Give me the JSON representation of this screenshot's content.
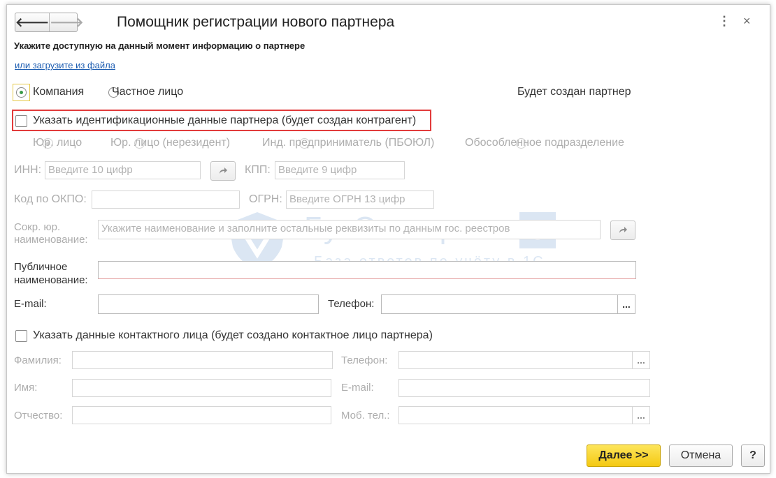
{
  "window": {
    "title": "Помощник регистрации нового партнера",
    "nav": {
      "back": "🡐",
      "forward": "🡒"
    },
    "menu_icon": "⋮",
    "close_icon": "×"
  },
  "prompt": "Укажите доступную на данный момент информацию о партнере",
  "load_link": "или загрузите из файла",
  "partner_type": {
    "company": "Компания",
    "private": "Частное лицо",
    "selected": "company"
  },
  "will_create": "Будет создан партнер",
  "ident_checkbox": "Указать идентификационные данные партнера (будет создан контрагент)",
  "legal_types": [
    "Юр. лицо",
    "Юр. лицо (нерезидент)",
    "Инд. предприниматель (ПБОЮЛ)",
    "Обособленное подразделение"
  ],
  "fields": {
    "inn_label": "ИНН:",
    "inn_placeholder": "Введите 10 цифр",
    "kpp_label": "КПП:",
    "kpp_placeholder": "Введите 9 цифр",
    "okpo_label": "Код по ОКПО:",
    "ogrn_label": "ОГРН:",
    "ogrn_placeholder": "Введите ОГРН 13 цифр",
    "short_name_label_1": "Сокр. юр.",
    "short_name_label_2": "наименование:",
    "short_name_placeholder": "Укажите наименование и заполните остальные реквизиты по данным гос. реестров",
    "public_name_label_1": "Публичное",
    "public_name_label_2": "наименование:",
    "email_label": "E-mail:",
    "phone_label": "Телефон:"
  },
  "contact": {
    "checkbox": "Указать данные контактного лица (будет создано контактное лицо партнера)",
    "surname": "Фамилия:",
    "name": "Имя:",
    "patronymic": "Отчество:",
    "phone": "Телефон:",
    "email": "E-mail:",
    "mobile": "Моб. тел.:"
  },
  "watermark": {
    "brand": "БухЭксперт",
    "badge": "8",
    "tagline": "База ответов по учёту в 1С"
  },
  "buttons": {
    "next": "Далее >>",
    "cancel": "Отмена",
    "help": "?",
    "dots": "..."
  },
  "colors": {
    "accent_yellow": "#f4c912",
    "highlight_red": "#e23b3b",
    "radio_green": "#3a9a49",
    "link_blue": "#1a5bb0"
  }
}
